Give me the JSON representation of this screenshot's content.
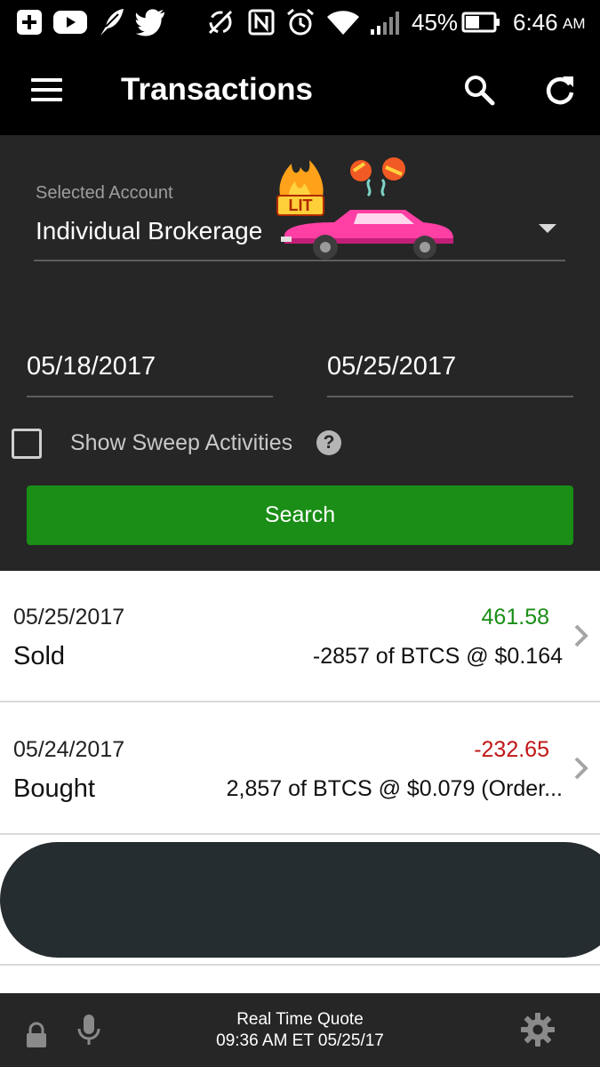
{
  "status_bar": {
    "battery_percent": "45%",
    "time": "6:46",
    "ampm": "AM",
    "icons": [
      "add-box-icon",
      "youtube-icon",
      "quill-icon",
      "twitter-icon",
      "sync-off-icon",
      "nfc-icon",
      "alarm-icon",
      "wifi-icon",
      "signal-icon",
      "battery-icon"
    ]
  },
  "app_bar": {
    "title": "Transactions",
    "icons": [
      "menu-icon",
      "search-icon",
      "refresh-icon"
    ]
  },
  "form": {
    "account_label": "Selected Account",
    "account_value": "Individual Brokerage",
    "sticker_text": "LIT",
    "date_from": "05/18/2017",
    "date_to": "05/25/2017",
    "sweep_label": "Show Sweep Activities",
    "sweep_checked": false,
    "help_glyph": "?",
    "search_label": "Search"
  },
  "transactions": [
    {
      "date": "05/25/2017",
      "type": "Sold",
      "amount": "461.58",
      "direction": "positive",
      "description": "-2857 of BTCS @ $0.164"
    },
    {
      "date": "05/24/2017",
      "type": "Bought",
      "amount": "-232.65",
      "direction": "negative",
      "description": "2,857 of BTCS @ $0.079 (Order..."
    }
  ],
  "bottom_bar": {
    "quote_title": "Real Time Quote",
    "quote_time": "09:36 AM ET 05/25/17",
    "icons": [
      "lock-icon",
      "mic-icon",
      "gear-icon"
    ]
  },
  "colors": {
    "app_bar_bg": "#000000",
    "panel_bg": "#262626",
    "accent_green": "#1a8e16",
    "negative_red": "#c01515",
    "sticker_pink": "#ff3fa4"
  }
}
